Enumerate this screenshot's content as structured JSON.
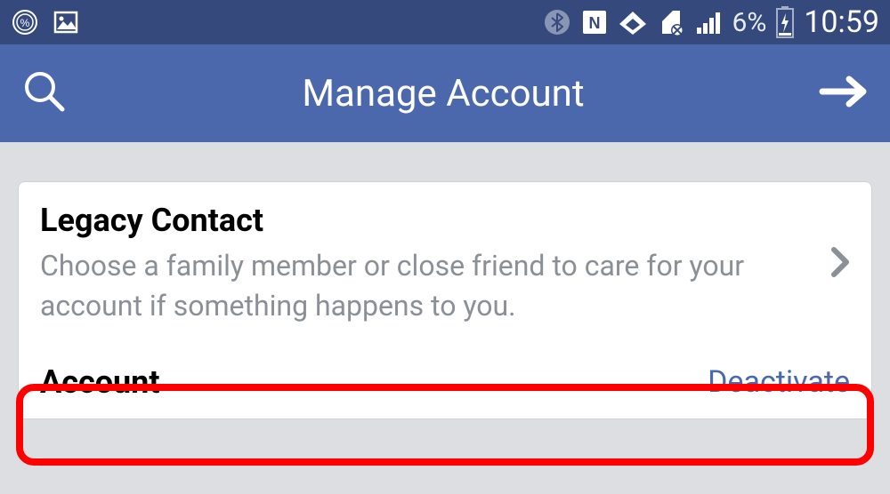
{
  "status_bar": {
    "battery_pct": "6%",
    "time": "10:59",
    "icons": {
      "percent_circle": "percent-circle-icon",
      "picture": "picture-icon",
      "bluetooth": "bluetooth-icon",
      "nfc": "nfc-icon",
      "wifi": "wifi-icon",
      "data_off": "data-off-icon",
      "signal": "signal-icon",
      "battery": "battery-charging-icon"
    }
  },
  "app_bar": {
    "title": "Manage Account"
  },
  "card": {
    "legacy": {
      "title": "Legacy Contact",
      "description": "Choose a family member or close friend to care for your account if something happens to you."
    },
    "account": {
      "title": "Account",
      "action": "Deactivate"
    }
  }
}
